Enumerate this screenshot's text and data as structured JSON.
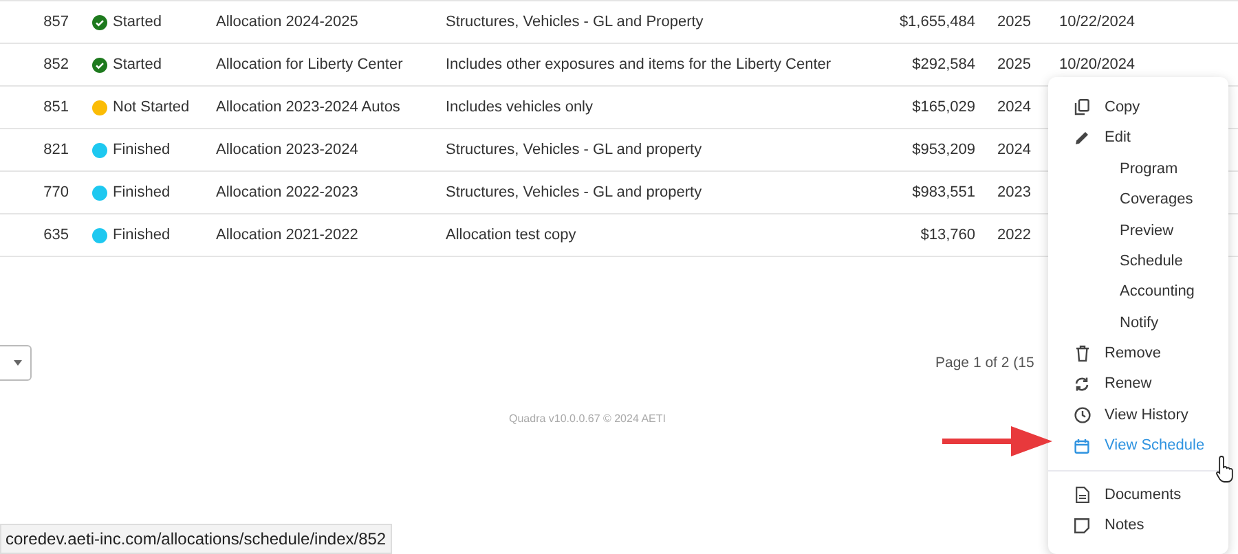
{
  "table": {
    "rows": [
      {
        "id": "857",
        "status": {
          "kind": "started",
          "label": "Started"
        },
        "name": "Allocation 2024-2025",
        "description": "Structures, Vehicles - GL and Property",
        "amount": "$1,655,484",
        "year": "2025",
        "date": "10/22/2024"
      },
      {
        "id": "852",
        "status": {
          "kind": "started",
          "label": "Started"
        },
        "name": "Allocation for Liberty Center",
        "description": "Includes other exposures and items for the Liberty Center",
        "amount": "$292,584",
        "year": "2025",
        "date": "10/20/2024"
      },
      {
        "id": "851",
        "status": {
          "kind": "not_started",
          "label": "Not Started"
        },
        "name": "Allocation 2023-2024 Autos",
        "description": "Includes vehicles only",
        "amount": "$165,029",
        "year": "2024"
      },
      {
        "id": "821",
        "status": {
          "kind": "finished",
          "label": "Finished"
        },
        "name": "Allocation 2023-2024",
        "description": "Structures, Vehicles - GL and property",
        "amount": "$953,209",
        "year": "2024"
      },
      {
        "id": "770",
        "status": {
          "kind": "finished",
          "label": "Finished"
        },
        "name": "Allocation 2022-2023",
        "description": "Structures, Vehicles - GL and property",
        "amount": "$983,551",
        "year": "2023"
      },
      {
        "id": "635",
        "status": {
          "kind": "finished",
          "label": "Finished"
        },
        "name": "Allocation 2021-2022",
        "description": "Allocation test copy",
        "amount": "$13,760",
        "year": "2022"
      }
    ]
  },
  "pagination": {
    "text": "Page 1 of 2 (15"
  },
  "footer": "Quadra v10.0.0.67 © 2024 AETI",
  "context_menu": {
    "items": [
      {
        "label": "Copy",
        "kind": "copy",
        "selected": false
      },
      {
        "label": "Edit",
        "kind": "edit",
        "selected": false,
        "children": [
          {
            "label": "Program",
            "selected": false
          },
          {
            "label": "Coverages",
            "selected": false
          },
          {
            "label": "Preview",
            "selected": false
          },
          {
            "label": "Schedule",
            "selected": false
          },
          {
            "label": "Accounting",
            "selected": false
          },
          {
            "label": "Notify",
            "selected": false
          }
        ]
      },
      {
        "label": "Remove",
        "kind": "remove",
        "selected": false
      },
      {
        "label": "Renew",
        "kind": "renew",
        "selected": false
      },
      {
        "label": "View History",
        "kind": "history",
        "selected": false
      },
      {
        "label": "View Schedule",
        "kind": "schedule",
        "selected": true
      },
      {
        "label": "Documents",
        "kind": "documents",
        "selected": false,
        "group_start": true
      },
      {
        "label": "Notes",
        "kind": "notes",
        "selected": false
      }
    ]
  },
  "status_bar": {
    "url": "coredev.aeti-inc.com/allocations/schedule/index/852"
  }
}
